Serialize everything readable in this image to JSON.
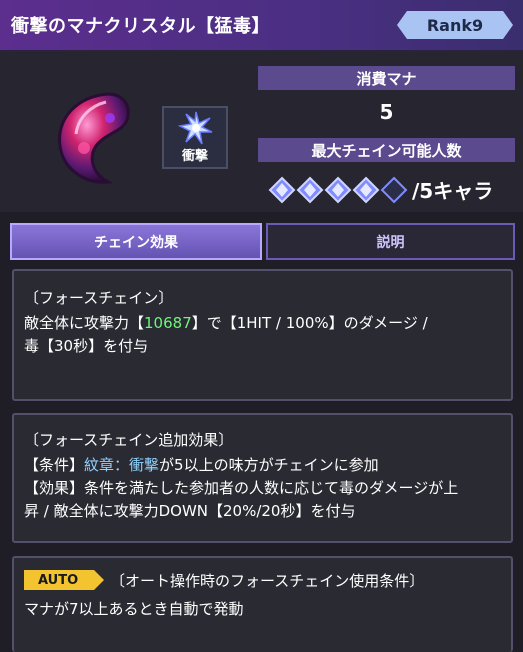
{
  "header": {
    "title": "衝撃のマナクリスタル【猛毒】",
    "rank": "Rank9"
  },
  "skill": {
    "attribute_label": "衝撃",
    "mana_cost_label": "消費マナ",
    "mana_cost_value": "5",
    "max_chain_label": "最大チェイン可能人数",
    "max_chain_suffix": "/5キャラ",
    "max_chain_value": 4,
    "max_chain_total": 5
  },
  "tabs": [
    {
      "label": "チェイン効果",
      "active": true
    },
    {
      "label": "説明",
      "active": false
    }
  ],
  "force_chain": {
    "heading": "〔フォースチェイン〕",
    "line1_a": "敵全体に攻撃力【",
    "line1_value": "10687",
    "line1_b": "】で【1HIT / 100%】のダメージ /",
    "line2": "毒【30秒】を付与"
  },
  "additional": {
    "heading": "〔フォースチェイン追加効果〕",
    "cond_a": "【条件】",
    "cond_highlight": "紋章：衝撃",
    "cond_b": "が5以上の味方がチェインに参加",
    "effect_a": "【効果】条件を満たした参加者の人数に応じて毒のダメージが上",
    "effect_b": "昇 / 敵全体に攻撃力DOWN【20%/20秒】を付与"
  },
  "auto": {
    "badge": "AUTO",
    "heading": "〔オート操作時のフォースチェイン使用条件〕",
    "text": "マナが7以上あるとき自動で発動"
  },
  "colors": {
    "accent_purple": "#5c4a8e",
    "value_green": "#6ff57a",
    "highlight_blue": "#8ed1ff",
    "auto_yellow": "#f4c430"
  }
}
